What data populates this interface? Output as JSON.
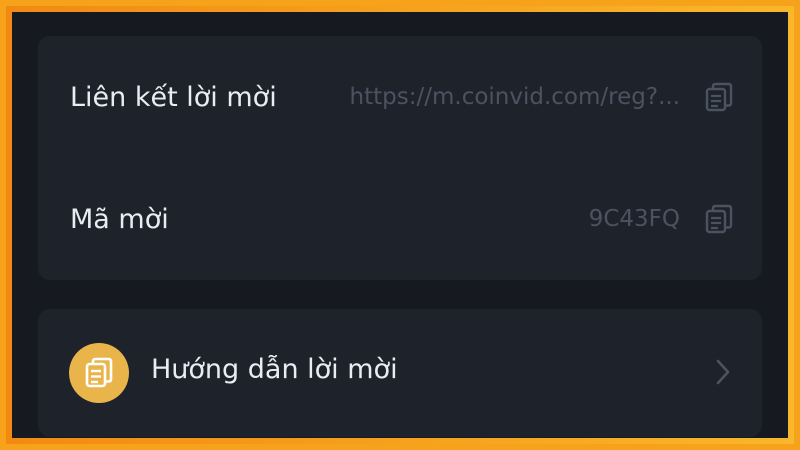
{
  "invite_card": {
    "link_label": "Liên kết lời mời",
    "link_value": "https://m.coinvid.com/reg?...",
    "code_label": "Mã mời",
    "code_value": "9C43FQ",
    "copy_icon": "copy-icon"
  },
  "guide": {
    "label": "Hướng dẫn lời mời",
    "icon": "document-icon",
    "chevron_icon": "chevron-right-icon"
  },
  "colors": {
    "border_accent": "#f7a21b",
    "background": "#161a20",
    "card": "#1e232b",
    "primary_text": "#e9ecf1",
    "muted_text": "#4b5361",
    "badge": "#e9b54b"
  }
}
